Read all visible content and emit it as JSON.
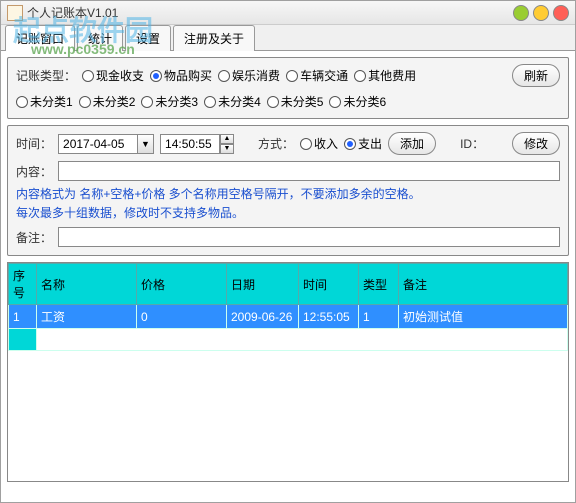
{
  "window": {
    "title": "个人记账本V1.01"
  },
  "watermark": {
    "main": "起点软件园",
    "sub": "www.pc0359.cn"
  },
  "tabs": [
    "记账窗口",
    "统计",
    "设置",
    "注册及关于"
  ],
  "type_section": {
    "label": "记账类型：",
    "row1": [
      "现金收支",
      "物品购买",
      "娱乐消费",
      "车辆交通",
      "其他费用"
    ],
    "row2": [
      "未分类1",
      "未分类2",
      "未分类3",
      "未分类4",
      "未分类5",
      "未分类6"
    ],
    "selected": "物品购买",
    "refresh": "刷新"
  },
  "entry": {
    "time_label": "时间：",
    "date": "2017-04-05",
    "time": "14:50:55",
    "mode_label": "方式：",
    "mode_in": "收入",
    "mode_out": "支出",
    "mode_selected": "支出",
    "add": "添加",
    "id_label": "ID：",
    "modify": "修改",
    "content_label": "内容：",
    "hint1": "内容格式为 名称+空格+价格 多个名称用空格号隔开，不要添加多余的空格。",
    "hint2": "每次最多十组数据，修改时不支持多物品。",
    "remark_label": "备注："
  },
  "table": {
    "headers": [
      "序号",
      "名称",
      "价格",
      "日期",
      "时间",
      "类型",
      "备注"
    ],
    "rows": [
      {
        "no": "1",
        "name": "工资",
        "price": "0",
        "date": "2009-06-26",
        "time": "12:55:05",
        "type": "1",
        "remark": "初始测试值"
      }
    ]
  }
}
